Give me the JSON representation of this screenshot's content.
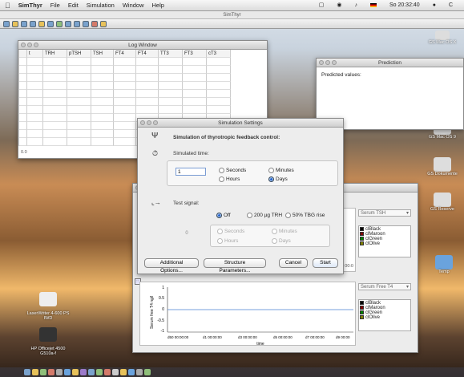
{
  "menubar": {
    "app": "SimThyr",
    "items": [
      "File",
      "Edit",
      "Simulation",
      "Window",
      "Help"
    ],
    "clock": "So 20:32:40",
    "user_initial": "C"
  },
  "appbar_title": "SimThyr",
  "log_window": {
    "title": "Log Window",
    "columns": [
      "",
      "t",
      "TRH",
      "pTSH",
      "TSH",
      "FT4",
      "FT4",
      "TT3",
      "FT3",
      "cT3"
    ],
    "first_row": "0.0"
  },
  "prediction": {
    "title": "Prediction",
    "label": "Predicted values:"
  },
  "dialog": {
    "title": "Simulation Settings",
    "heading": "Simulation of thyrotropic feedback control:",
    "sim_time_label": "Simulated time:",
    "sim_time_value": "1",
    "units": [
      "Seconds",
      "Minutes",
      "Hours",
      "Days"
    ],
    "test_signal_label": "Test signal:",
    "signal_options": [
      "Off",
      "200 µg TRH",
      "50% TBG rise"
    ],
    "signal_value": "0",
    "buttons": {
      "additional": "Additional Options...",
      "structure": "Structure Parameters...",
      "cancel": "Cancel",
      "start": "Start"
    }
  },
  "plot_window": {
    "select1": "Serum TSH",
    "select2": "Serum Free T4",
    "colors": [
      "clBlack",
      "clMaroon",
      "clGreen",
      "clOlive"
    ],
    "swatches": [
      "#000000",
      "#800000",
      "#008000",
      "#808000"
    ],
    "ylabel": "Serum free T4 ng/l",
    "yticks": [
      "1",
      "0.5",
      "0",
      "-0.5",
      "-1"
    ],
    "xticks": [
      "d50 00:00:00",
      "d1 00:00:00",
      "d3 00:00:00",
      "d5 00:00:00",
      "d7 00:00:00",
      "d9 00:00"
    ],
    "xlabel": "time",
    "top_tick": "00:0",
    "top_values": [
      "00:0"
    ]
  },
  "desktop": {
    "icons": [
      "GS Mac OS 9",
      "GS Dokumente",
      "GS Reserve",
      "Temp",
      "GS Mac OS X"
    ],
    "printers": [
      "LaserWriter 4-600 PS\nIWD",
      "HP Officejet 4500\nG510a-f"
    ]
  }
}
